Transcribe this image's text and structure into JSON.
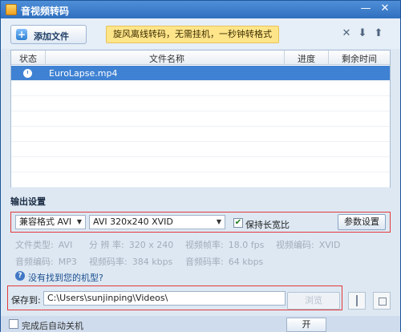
{
  "window": {
    "title": "音视频转码"
  },
  "toolbar": {
    "add_label": "添加文件",
    "promo_text": "旋风离线转码，无需挂机，一秒钟转格式",
    "icons": [
      "delete-icon",
      "move-down-icon",
      "move-up-icon"
    ]
  },
  "list": {
    "columns": [
      "状态",
      "文件名称",
      "进度",
      "剩余时间"
    ],
    "rows": [
      {
        "status_icon": "clock-icon",
        "name": "EuroLapse.mp4",
        "progress": "",
        "remaining": ""
      }
    ]
  },
  "output": {
    "section_title": "输出设置",
    "format_select": "兼容格式 AVI",
    "codec_select": "AVI 320x240 XVID",
    "keep_ratio_label": "保持长宽比",
    "keep_ratio_checked": true,
    "param_button": "参数设置",
    "info_row1": [
      {
        "label": "文件类型:",
        "value": "AVI"
      },
      {
        "label": "分 辨 率:",
        "value": "320 x 240"
      },
      {
        "label": "视频帧率:",
        "value": "18.0 fps"
      },
      {
        "label": "视频编码:",
        "value": "XVID"
      }
    ],
    "info_row2": [
      {
        "label": "音频编码:",
        "value": "MP3"
      },
      {
        "label": "视频码率:",
        "value": "384 kbps"
      },
      {
        "label": "音频码率:",
        "value": "64 kbps"
      }
    ],
    "help_link": "没有找到您的机型?",
    "save_label": "保存到:",
    "save_path": "C:\\Users\\sunjinping\\Videos\\",
    "browse_button": "浏览"
  },
  "bottom": {
    "shutdown_label": "完成后自动关机",
    "start_button": "开"
  },
  "colors": {
    "selection": "#3f82d3",
    "highlight_border": "#e23b3b",
    "promo_bg": "#ffe58a"
  }
}
